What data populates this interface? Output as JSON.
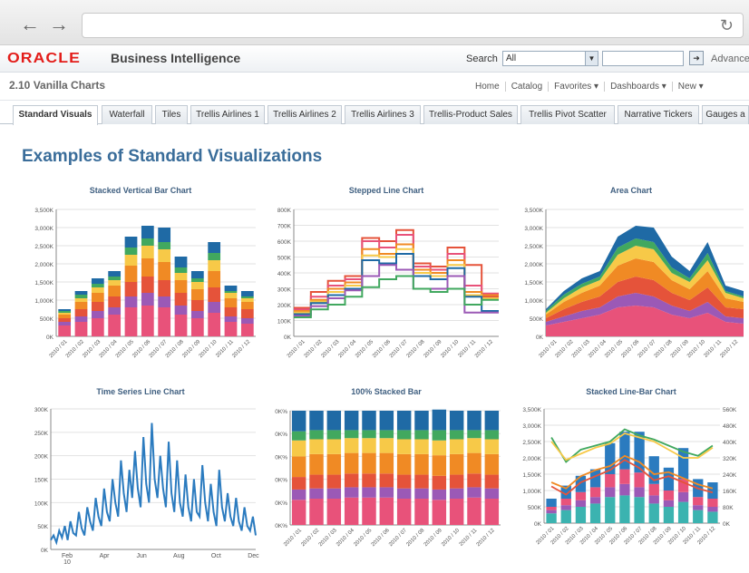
{
  "browser": {
    "back_icon": "←",
    "forward_icon": "→",
    "reload_icon": "↻",
    "url": ""
  },
  "header": {
    "logo": "ORACLE",
    "app_title": "Business Intelligence",
    "search_label": "Search",
    "search_scope": "All",
    "advanced_label": "Advanced"
  },
  "sub_header": {
    "dashboard_title": "2.10 Vanilla Charts",
    "links": [
      "Home",
      "Catalog",
      "Favorites ▾",
      "Dashboards ▾",
      "New ▾"
    ]
  },
  "tabs": [
    "Standard Visuals",
    "Waterfall",
    "Tiles",
    "Trellis Airlines 1",
    "Trellis Airlines 2",
    "Trellis Airlines 3",
    "Trellis-Product Sales",
    "Trellis Pivot Scatter",
    "Narrative Tickers",
    "Gauges a"
  ],
  "page_heading": "Examples of Standard Visualizations",
  "colors": {
    "blue": "#1f6aa5",
    "green": "#41a85f",
    "yellow": "#f7c948",
    "orange": "#f08a24",
    "red": "#e5533a",
    "purple": "#9b59b6",
    "pink": "#e8527a",
    "teal": "#3bb3b0",
    "line_blue": "#2b7bbf"
  },
  "chart_data": [
    {
      "type": "bar",
      "title": "Stacked Vertical Bar Chart",
      "categories": [
        "2010 / 01",
        "2010 / 02",
        "2010 / 03",
        "2010 / 04",
        "2010 / 05",
        "2010 / 06",
        "2010 / 07",
        "2010 / 08",
        "2010 / 09",
        "2010 / 10",
        "2010 / 11",
        "2010 / 12"
      ],
      "y_ticks": [
        "0K",
        "500K",
        "1,000K",
        "1,500K",
        "2,000K",
        "2,500K",
        "3,000K",
        "3,500K"
      ],
      "ylim": [
        0,
        3500
      ],
      "series": [
        {
          "color": "pink",
          "values": [
            300,
            400,
            500,
            600,
            800,
            850,
            800,
            600,
            500,
            650,
            400,
            350
          ]
        },
        {
          "color": "purple",
          "values": [
            100,
            150,
            200,
            200,
            300,
            350,
            300,
            250,
            200,
            300,
            150,
            150
          ]
        },
        {
          "color": "red",
          "values": [
            100,
            200,
            250,
            300,
            400,
            450,
            450,
            350,
            300,
            400,
            250,
            250
          ]
        },
        {
          "color": "orange",
          "values": [
            100,
            200,
            250,
            300,
            450,
            500,
            500,
            350,
            300,
            450,
            250,
            200
          ]
        },
        {
          "color": "yellow",
          "values": [
            50,
            100,
            150,
            150,
            300,
            350,
            350,
            200,
            200,
            300,
            150,
            100
          ]
        },
        {
          "color": "green",
          "values": [
            50,
            100,
            100,
            100,
            200,
            200,
            200,
            150,
            100,
            200,
            50,
            50
          ]
        },
        {
          "color": "blue",
          "values": [
            50,
            100,
            150,
            150,
            300,
            350,
            400,
            300,
            200,
            300,
            150,
            150
          ]
        }
      ]
    },
    {
      "type": "line",
      "title": "Stepped Line Chart",
      "categories": [
        "2010 / 01",
        "2010 / 02",
        "2010 / 03",
        "2010 / 04",
        "2010 / 05",
        "2010 / 06",
        "2010 / 07",
        "2010 / 08",
        "2010 / 09",
        "2010 / 10",
        "2010 / 11",
        "2010 / 12"
      ],
      "y_ticks": [
        "0K",
        "100K",
        "200K",
        "300K",
        "400K",
        "500K",
        "600K",
        "700K",
        "800K"
      ],
      "ylim": [
        0,
        800
      ],
      "series": [
        {
          "color": "red",
          "values": [
            180,
            280,
            350,
            380,
            620,
            600,
            670,
            460,
            440,
            560,
            450,
            250
          ]
        },
        {
          "color": "pink",
          "values": [
            170,
            250,
            320,
            360,
            600,
            560,
            640,
            440,
            420,
            520,
            320,
            270
          ]
        },
        {
          "color": "orange",
          "values": [
            160,
            230,
            300,
            340,
            550,
            520,
            580,
            420,
            400,
            480,
            280,
            260
          ]
        },
        {
          "color": "yellow",
          "values": [
            150,
            220,
            280,
            320,
            510,
            500,
            550,
            400,
            380,
            450,
            260,
            240
          ]
        },
        {
          "color": "blue",
          "values": [
            140,
            210,
            260,
            300,
            480,
            460,
            520,
            380,
            360,
            430,
            250,
            160
          ]
        },
        {
          "color": "purple",
          "values": [
            130,
            190,
            240,
            290,
            380,
            450,
            420,
            300,
            300,
            380,
            150,
            150
          ]
        },
        {
          "color": "green",
          "values": [
            120,
            170,
            200,
            250,
            310,
            360,
            380,
            300,
            280,
            300,
            200,
            230
          ]
        }
      ]
    },
    {
      "type": "area",
      "title": "Area Chart",
      "categories": [
        "2010 / 01",
        "2010 / 02",
        "2010 / 03",
        "2010 / 04",
        "2010 / 05",
        "2010 / 06",
        "2010 / 07",
        "2010 / 08",
        "2010 / 09",
        "2010 / 10",
        "2010 / 11",
        "2010 / 12"
      ],
      "y_ticks": [
        "0K",
        "500K",
        "1,000K",
        "1,500K",
        "2,000K",
        "2,500K",
        "3,000K",
        "3,500K"
      ],
      "ylim": [
        0,
        3500
      ],
      "series": [
        {
          "color": "pink",
          "values": [
            300,
            400,
            500,
            600,
            800,
            850,
            800,
            600,
            500,
            650,
            400,
            350
          ]
        },
        {
          "color": "purple",
          "values": [
            100,
            150,
            200,
            200,
            300,
            350,
            300,
            250,
            200,
            300,
            150,
            150
          ]
        },
        {
          "color": "red",
          "values": [
            100,
            200,
            250,
            300,
            400,
            450,
            450,
            350,
            300,
            400,
            250,
            250
          ]
        },
        {
          "color": "orange",
          "values": [
            100,
            200,
            250,
            300,
            450,
            500,
            500,
            350,
            300,
            450,
            250,
            200
          ]
        },
        {
          "color": "yellow",
          "values": [
            50,
            100,
            150,
            150,
            300,
            350,
            350,
            200,
            200,
            300,
            150,
            100
          ]
        },
        {
          "color": "green",
          "values": [
            50,
            100,
            100,
            100,
            200,
            200,
            200,
            150,
            100,
            200,
            50,
            50
          ]
        },
        {
          "color": "blue",
          "values": [
            50,
            100,
            150,
            150,
            300,
            350,
            400,
            300,
            200,
            300,
            150,
            150
          ]
        }
      ]
    },
    {
      "type": "line",
      "title": "Time Series Line Chart",
      "x_ticks": [
        "Feb\n10",
        "Apr",
        "Jun",
        "Aug",
        "Oct",
        "Dec"
      ],
      "y_ticks": [
        "0K",
        "50K",
        "100K",
        "150K",
        "200K",
        "250K",
        "300K"
      ],
      "ylim": [
        0,
        300
      ],
      "series": [
        {
          "color": "line_blue",
          "values": [
            20,
            30,
            15,
            40,
            25,
            50,
            20,
            60,
            35,
            30,
            80,
            45,
            30,
            90,
            60,
            40,
            110,
            70,
            50,
            130,
            80,
            60,
            150,
            100,
            70,
            190,
            120,
            80,
            170,
            110,
            210,
            130,
            90,
            240,
            140,
            100,
            270,
            150,
            110,
            200,
            130,
            90,
            230,
            120,
            80,
            190,
            100,
            70,
            160,
            90,
            60,
            150,
            80,
            70,
            180,
            100,
            60,
            140,
            80,
            50,
            170,
            90,
            60,
            120,
            70,
            50,
            110,
            60,
            40,
            90,
            50,
            40,
            70,
            30
          ]
        }
      ]
    },
    {
      "type": "bar",
      "title": "100% Stacked Bar",
      "categories": [
        "2010 / 01",
        "2010 / 02",
        "2010 / 03",
        "2010 / 04",
        "2010 / 05",
        "2010 / 06",
        "2010 / 07",
        "2010 / 08",
        "2010 / 09",
        "2010 / 10",
        "2010 / 11",
        "2010 / 12"
      ],
      "y_ticks": [
        "0K%",
        "0K%",
        "0K%",
        "0K%",
        "0K%",
        "0K%"
      ],
      "ylim": [
        0,
        100
      ],
      "series": [
        {
          "color": "pink",
          "values": [
            22,
            23,
            23,
            24,
            24,
            24,
            23,
            23,
            22,
            23,
            24,
            23
          ]
        },
        {
          "color": "purple",
          "values": [
            9,
            9,
            9,
            9,
            9,
            9,
            9,
            9,
            9,
            9,
            9,
            9
          ]
        },
        {
          "color": "red",
          "values": [
            11,
            12,
            12,
            12,
            12,
            12,
            12,
            12,
            12,
            12,
            12,
            12
          ]
        },
        {
          "color": "orange",
          "values": [
            18,
            18,
            18,
            18,
            18,
            18,
            18,
            18,
            18,
            18,
            18,
            18
          ]
        },
        {
          "color": "yellow",
          "values": [
            14,
            13,
            13,
            13,
            13,
            13,
            13,
            13,
            13,
            13,
            13,
            13
          ]
        },
        {
          "color": "green",
          "values": [
            8,
            8,
            8,
            7,
            7,
            7,
            8,
            8,
            9,
            8,
            7,
            8
          ]
        },
        {
          "color": "blue",
          "values": [
            18,
            17,
            17,
            17,
            17,
            17,
            17,
            17,
            18,
            17,
            17,
            17
          ]
        }
      ]
    },
    {
      "type": "bar",
      "title": "Stacked Line-Bar Chart",
      "categories": [
        "2010 / 01",
        "2010 / 02",
        "2010 / 03",
        "2010 / 04",
        "2010 / 05",
        "2010 / 06",
        "2010 / 07",
        "2010 / 08",
        "2010 / 09",
        "2010 / 10",
        "2010 / 11",
        "2010 / 12"
      ],
      "y_ticks": [
        "0K",
        "500K",
        "1,000K",
        "1,500K",
        "2,000K",
        "2,500K",
        "3,000K",
        "3,500K"
      ],
      "y2_ticks": [
        "0K",
        "80K",
        "160K",
        "240K",
        "320K",
        "400K",
        "480K",
        "560K"
      ],
      "ylim": [
        0,
        3500
      ],
      "series": [
        {
          "color": "teal",
          "values": [
            300,
            400,
            500,
            600,
            800,
            850,
            800,
            600,
            500,
            650,
            400,
            350
          ]
        },
        {
          "color": "purple",
          "values": [
            100,
            150,
            200,
            200,
            300,
            350,
            300,
            250,
            200,
            300,
            150,
            150
          ]
        },
        {
          "color": "pink",
          "values": [
            100,
            200,
            250,
            300,
            400,
            450,
            450,
            350,
            300,
            400,
            250,
            250
          ]
        },
        {
          "color": "line_blue",
          "values": [
            250,
            400,
            500,
            550,
            950,
            1150,
            1250,
            850,
            700,
            950,
            550,
            500
          ]
        }
      ],
      "lines": [
        {
          "color": "green",
          "values": [
            420,
            300,
            360,
            380,
            400,
            460,
            430,
            410,
            380,
            350,
            330,
            380
          ]
        },
        {
          "color": "yellow",
          "values": [
            400,
            310,
            340,
            370,
            390,
            440,
            420,
            400,
            360,
            320,
            320,
            370
          ]
        },
        {
          "color": "red",
          "values": [
            180,
            140,
            200,
            230,
            260,
            310,
            270,
            210,
            230,
            200,
            170,
            150
          ]
        },
        {
          "color": "orange",
          "values": [
            200,
            170,
            230,
            260,
            280,
            330,
            300,
            240,
            250,
            220,
            190,
            170
          ]
        }
      ]
    }
  ]
}
